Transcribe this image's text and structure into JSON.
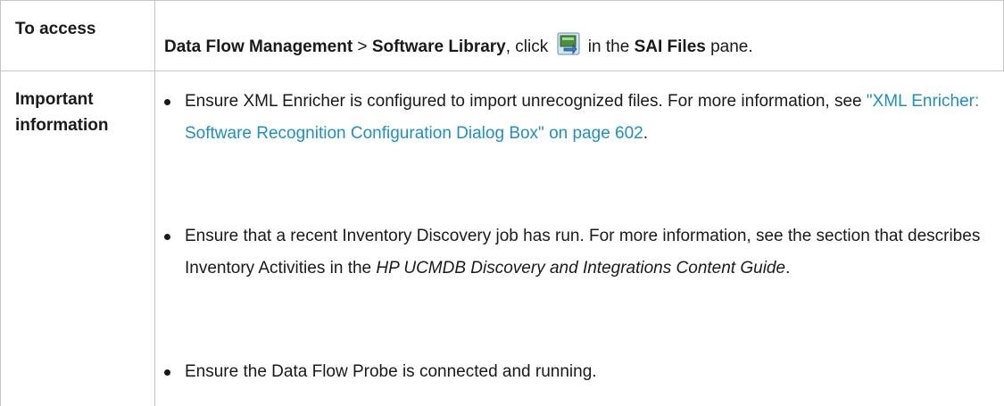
{
  "rows": {
    "access": {
      "label": "To access",
      "path_part1": "Data Flow Management",
      "separator": " > ",
      "path_part2": "Software Library",
      "click_text": ", click ",
      "in_the_text": " in the ",
      "pane_name": "SAI Files",
      "pane_suffix": " pane."
    },
    "important": {
      "label_line1": "Important",
      "label_line2": "information",
      "bullets": [
        {
          "text_before": "Ensure XML Enricher is configured to import unrecognized files. For more information, see ",
          "link": "\"XML Enricher: Software Recognition Configuration Dialog Box\" on page 602",
          "text_after": "."
        },
        {
          "text_before": "Ensure that a recent Inventory Discovery job has run. For more information, see the section that describes Inventory Activities in the ",
          "emphasis": "HP UCMDB Discovery and Integrations Content Guide",
          "text_after": "."
        },
        {
          "text": "Ensure the Data Flow Probe is connected and running."
        }
      ]
    }
  },
  "icons": {
    "toolbar": "import-sai-file-icon"
  },
  "colors": {
    "link": "#1f8fc8",
    "border": "#c6c6c6",
    "text": "#1a1a1a"
  }
}
